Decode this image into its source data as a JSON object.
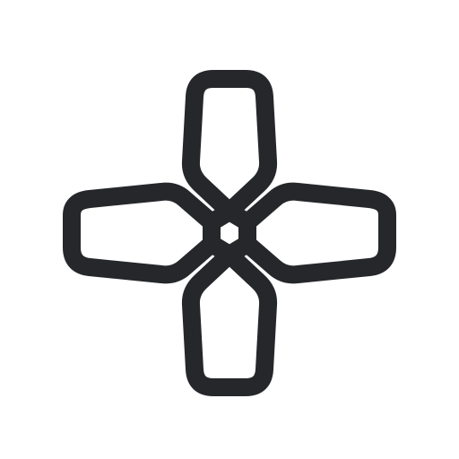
{
  "icon": {
    "name": "dpad-cross-icon",
    "stroke_color": "#25272b",
    "background_color": "#ffffff"
  }
}
